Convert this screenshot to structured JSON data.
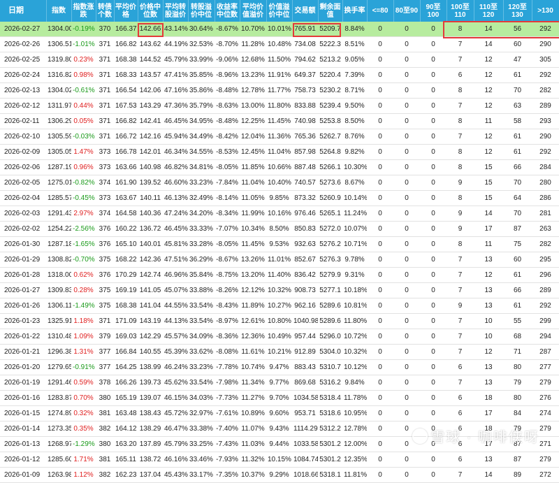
{
  "headers": [
    "日期",
    "指数",
    "指数涨跌",
    "转债个数",
    "平均价格",
    "价格中位数",
    "平均转股溢价",
    "转股溢价中位",
    "收益率中位数",
    "平均价值溢价",
    "价值溢价中位",
    "交易额",
    "剩余面值",
    "换手率",
    "<=80",
    "80至90",
    "90至100",
    "100至110",
    "110至120",
    "120至130",
    ">130"
  ],
  "rows": [
    {
      "date": "2026-02-27",
      "index": "1304.00",
      "chg": "-0.19%",
      "dir": "neg",
      "count": "370",
      "avg_price": "166.37",
      "median_price": "142.66",
      "avg_conv": "43.14%",
      "med_conv": "30.64%",
      "yield": "-8.67%",
      "avg_val": "10.70%",
      "med_val": "10.01%",
      "trade": "765.91",
      "face": "5209.7",
      "turnover": "8.84%",
      "b1": "0",
      "b2": "0",
      "b3": "0",
      "b4": "8",
      "b5": "14",
      "b6": "56",
      "b7": "292"
    },
    {
      "date": "2026-02-26",
      "index": "1306.51",
      "chg": "-1.01%",
      "dir": "neg",
      "count": "371",
      "avg_price": "166.82",
      "median_price": "143.62",
      "avg_conv": "44.19%",
      "med_conv": "32.53%",
      "yield": "-8.70%",
      "avg_val": "11.28%",
      "med_val": "10.48%",
      "trade": "734.08",
      "face": "5222.3",
      "turnover": "8.51%",
      "b1": "0",
      "b2": "0",
      "b3": "0",
      "b4": "7",
      "b5": "14",
      "b6": "60",
      "b7": "290"
    },
    {
      "date": "2026-02-25",
      "index": "1319.80",
      "chg": "0.23%",
      "dir": "pos",
      "count": "371",
      "avg_price": "168.38",
      "median_price": "144.52",
      "avg_conv": "45.79%",
      "med_conv": "33.99%",
      "yield": "-9.06%",
      "avg_val": "12.68%",
      "med_val": "11.50%",
      "trade": "794.62",
      "face": "5213.2",
      "turnover": "9.05%",
      "b1": "0",
      "b2": "0",
      "b3": "0",
      "b4": "7",
      "b5": "12",
      "b6": "47",
      "b7": "305"
    },
    {
      "date": "2026-02-24",
      "index": "1316.82",
      "chg": "0.98%",
      "dir": "pos",
      "count": "371",
      "avg_price": "168.33",
      "median_price": "143.57",
      "avg_conv": "47.41%",
      "med_conv": "35.85%",
      "yield": "-8.96%",
      "avg_val": "13.23%",
      "med_val": "11.91%",
      "trade": "649.37",
      "face": "5220.4",
      "turnover": "7.39%",
      "b1": "0",
      "b2": "0",
      "b3": "0",
      "b4": "6",
      "b5": "12",
      "b6": "61",
      "b7": "292"
    },
    {
      "date": "2026-02-13",
      "index": "1304.02",
      "chg": "-0.61%",
      "dir": "neg",
      "count": "371",
      "avg_price": "166.54",
      "median_price": "142.06",
      "avg_conv": "47.16%",
      "med_conv": "35.86%",
      "yield": "-8.48%",
      "avg_val": "12.78%",
      "med_val": "11.77%",
      "trade": "758.73",
      "face": "5230.2",
      "turnover": "8.71%",
      "b1": "0",
      "b2": "0",
      "b3": "0",
      "b4": "8",
      "b5": "12",
      "b6": "70",
      "b7": "282"
    },
    {
      "date": "2026-02-12",
      "index": "1311.97",
      "chg": "0.44%",
      "dir": "pos",
      "count": "371",
      "avg_price": "167.53",
      "median_price": "143.29",
      "avg_conv": "47.36%",
      "med_conv": "35.79%",
      "yield": "-8.63%",
      "avg_val": "13.00%",
      "med_val": "11.80%",
      "trade": "833.88",
      "face": "5239.4",
      "turnover": "9.50%",
      "b1": "0",
      "b2": "0",
      "b3": "0",
      "b4": "7",
      "b5": "12",
      "b6": "63",
      "b7": "289"
    },
    {
      "date": "2026-02-11",
      "index": "1306.29",
      "chg": "0.05%",
      "dir": "pos",
      "count": "371",
      "avg_price": "166.82",
      "median_price": "142.41",
      "avg_conv": "46.45%",
      "med_conv": "34.95%",
      "yield": "-8.48%",
      "avg_val": "12.25%",
      "med_val": "11.45%",
      "trade": "740.98",
      "face": "5253.8",
      "turnover": "8.50%",
      "b1": "0",
      "b2": "0",
      "b3": "0",
      "b4": "8",
      "b5": "11",
      "b6": "58",
      "b7": "293"
    },
    {
      "date": "2026-02-10",
      "index": "1305.59",
      "chg": "-0.03%",
      "dir": "neg",
      "count": "371",
      "avg_price": "166.72",
      "median_price": "142.16",
      "avg_conv": "45.94%",
      "med_conv": "34.49%",
      "yield": "-8.42%",
      "avg_val": "12.04%",
      "med_val": "11.36%",
      "trade": "765.36",
      "face": "5262.7",
      "turnover": "8.76%",
      "b1": "0",
      "b2": "0",
      "b3": "0",
      "b4": "7",
      "b5": "12",
      "b6": "61",
      "b7": "290"
    },
    {
      "date": "2026-02-09",
      "index": "1305.05",
      "chg": "1.47%",
      "dir": "pos",
      "count": "373",
      "avg_price": "166.78",
      "median_price": "142.01",
      "avg_conv": "46.34%",
      "med_conv": "34.55%",
      "yield": "-8.53%",
      "avg_val": "12.45%",
      "med_val": "11.04%",
      "trade": "857.98",
      "face": "5264.8",
      "turnover": "9.82%",
      "b1": "0",
      "b2": "0",
      "b3": "0",
      "b4": "8",
      "b5": "12",
      "b6": "61",
      "b7": "292"
    },
    {
      "date": "2026-02-06",
      "index": "1287.19",
      "chg": "0.96%",
      "dir": "pos",
      "count": "373",
      "avg_price": "163.66",
      "median_price": "140.98",
      "avg_conv": "46.82%",
      "med_conv": "34.81%",
      "yield": "-8.05%",
      "avg_val": "11.85%",
      "med_val": "10.66%",
      "trade": "887.48",
      "face": "5266.1",
      "turnover": "10.30%",
      "b1": "0",
      "b2": "0",
      "b3": "0",
      "b4": "8",
      "b5": "15",
      "b6": "66",
      "b7": "284"
    },
    {
      "date": "2026-02-05",
      "index": "1275.01",
      "chg": "-0.82%",
      "dir": "neg",
      "count": "374",
      "avg_price": "161.90",
      "median_price": "139.52",
      "avg_conv": "46.60%",
      "med_conv": "33.23%",
      "yield": "-7.84%",
      "avg_val": "11.04%",
      "med_val": "10.40%",
      "trade": "740.57",
      "face": "5273.6",
      "turnover": "8.67%",
      "b1": "0",
      "b2": "0",
      "b3": "0",
      "b4": "9",
      "b5": "15",
      "b6": "70",
      "b7": "280"
    },
    {
      "date": "2026-02-04",
      "index": "1285.57",
      "chg": "-0.45%",
      "dir": "neg",
      "count": "373",
      "avg_price": "163.67",
      "median_price": "140.11",
      "avg_conv": "46.13%",
      "med_conv": "32.49%",
      "yield": "-8.14%",
      "avg_val": "11.05%",
      "med_val": "9.85%",
      "trade": "873.32",
      "face": "5260.9",
      "turnover": "10.14%",
      "b1": "0",
      "b2": "0",
      "b3": "0",
      "b4": "8",
      "b5": "15",
      "b6": "64",
      "b7": "286"
    },
    {
      "date": "2026-02-03",
      "index": "1291.43",
      "chg": "2.97%",
      "dir": "pos",
      "count": "374",
      "avg_price": "164.58",
      "median_price": "140.36",
      "avg_conv": "47.24%",
      "med_conv": "34.20%",
      "yield": "-8.34%",
      "avg_val": "11.99%",
      "med_val": "10.16%",
      "trade": "976.46",
      "face": "5265.1",
      "turnover": "11.24%",
      "b1": "0",
      "b2": "0",
      "b3": "0",
      "b4": "9",
      "b5": "14",
      "b6": "70",
      "b7": "281"
    },
    {
      "date": "2026-02-02",
      "index": "1254.22",
      "chg": "-2.56%",
      "dir": "neg",
      "count": "376",
      "avg_price": "160.22",
      "median_price": "136.72",
      "avg_conv": "46.45%",
      "med_conv": "33.33%",
      "yield": "-7.07%",
      "avg_val": "10.34%",
      "med_val": "8.50%",
      "trade": "850.83",
      "face": "5272.0",
      "turnover": "10.07%",
      "b1": "0",
      "b2": "0",
      "b3": "0",
      "b4": "9",
      "b5": "17",
      "b6": "87",
      "b7": "263"
    },
    {
      "date": "2026-01-30",
      "index": "1287.18",
      "chg": "-1.65%",
      "dir": "neg",
      "count": "376",
      "avg_price": "165.10",
      "median_price": "140.01",
      "avg_conv": "45.81%",
      "med_conv": "33.28%",
      "yield": "-8.05%",
      "avg_val": "11.45%",
      "med_val": "9.53%",
      "trade": "932.63",
      "face": "5276.2",
      "turnover": "10.71%",
      "b1": "0",
      "b2": "0",
      "b3": "0",
      "b4": "8",
      "b5": "11",
      "b6": "75",
      "b7": "282"
    },
    {
      "date": "2026-01-29",
      "index": "1308.82",
      "chg": "-0.70%",
      "dir": "neg",
      "count": "375",
      "avg_price": "168.22",
      "median_price": "142.36",
      "avg_conv": "47.51%",
      "med_conv": "36.29%",
      "yield": "-8.67%",
      "avg_val": "13.26%",
      "med_val": "11.01%",
      "trade": "852.67",
      "face": "5276.3",
      "turnover": "9.78%",
      "b1": "0",
      "b2": "0",
      "b3": "0",
      "b4": "7",
      "b5": "13",
      "b6": "60",
      "b7": "295"
    },
    {
      "date": "2026-01-28",
      "index": "1318.00",
      "chg": "0.62%",
      "dir": "pos",
      "count": "376",
      "avg_price": "170.29",
      "median_price": "142.74",
      "avg_conv": "46.96%",
      "med_conv": "35.84%",
      "yield": "-8.75%",
      "avg_val": "13.20%",
      "med_val": "11.40%",
      "trade": "836.42",
      "face": "5279.9",
      "turnover": "9.31%",
      "b1": "0",
      "b2": "0",
      "b3": "0",
      "b4": "7",
      "b5": "12",
      "b6": "61",
      "b7": "296"
    },
    {
      "date": "2026-01-27",
      "index": "1309.83",
      "chg": "0.28%",
      "dir": "pos",
      "count": "375",
      "avg_price": "169.19",
      "median_price": "141.05",
      "avg_conv": "45.07%",
      "med_conv": "33.88%",
      "yield": "-8.26%",
      "avg_val": "12.12%",
      "med_val": "10.32%",
      "trade": "908.73",
      "face": "5277.1",
      "turnover": "10.18%",
      "b1": "0",
      "b2": "0",
      "b3": "0",
      "b4": "7",
      "b5": "13",
      "b6": "66",
      "b7": "289"
    },
    {
      "date": "2026-01-26",
      "index": "1306.11",
      "chg": "-1.49%",
      "dir": "neg",
      "count": "375",
      "avg_price": "168.38",
      "median_price": "141.04",
      "avg_conv": "44.55%",
      "med_conv": "33.54%",
      "yield": "-8.43%",
      "avg_val": "11.89%",
      "med_val": "10.27%",
      "trade": "962.16",
      "face": "5289.6",
      "turnover": "10.81%",
      "b1": "0",
      "b2": "0",
      "b3": "0",
      "b4": "9",
      "b5": "13",
      "b6": "61",
      "b7": "292"
    },
    {
      "date": "2026-01-23",
      "index": "1325.91",
      "chg": "1.18%",
      "dir": "pos",
      "count": "371",
      "avg_price": "171.09",
      "median_price": "143.19",
      "avg_conv": "44.13%",
      "med_conv": "33.54%",
      "yield": "-8.97%",
      "avg_val": "12.61%",
      "med_val": "10.80%",
      "trade": "1040.98",
      "face": "5289.6",
      "turnover": "11.80%",
      "b1": "0",
      "b2": "0",
      "b3": "0",
      "b4": "7",
      "b5": "10",
      "b6": "55",
      "b7": "299"
    },
    {
      "date": "2026-01-22",
      "index": "1310.48",
      "chg": "1.09%",
      "dir": "pos",
      "count": "379",
      "avg_price": "169.03",
      "median_price": "142.29",
      "avg_conv": "45.57%",
      "med_conv": "34.09%",
      "yield": "-8.36%",
      "avg_val": "12.36%",
      "med_val": "10.49%",
      "trade": "957.44",
      "face": "5296.0",
      "turnover": "10.72%",
      "b1": "0",
      "b2": "0",
      "b3": "0",
      "b4": "7",
      "b5": "10",
      "b6": "68",
      "b7": "294"
    },
    {
      "date": "2026-01-21",
      "index": "1296.38",
      "chg": "1.31%",
      "dir": "pos",
      "count": "377",
      "avg_price": "166.84",
      "median_price": "140.55",
      "avg_conv": "45.39%",
      "med_conv": "33.62%",
      "yield": "-8.08%",
      "avg_val": "11.61%",
      "med_val": "10.21%",
      "trade": "912.89",
      "face": "5304.0",
      "turnover": "10.32%",
      "b1": "0",
      "b2": "0",
      "b3": "0",
      "b4": "7",
      "b5": "12",
      "b6": "71",
      "b7": "287"
    },
    {
      "date": "2026-01-20",
      "index": "1279.65",
      "chg": "-0.91%",
      "dir": "neg",
      "count": "377",
      "avg_price": "164.25",
      "median_price": "138.99",
      "avg_conv": "46.24%",
      "med_conv": "33.23%",
      "yield": "-7.78%",
      "avg_val": "10.74%",
      "med_val": "9.47%",
      "trade": "883.43",
      "face": "5310.7",
      "turnover": "10.12%",
      "b1": "0",
      "b2": "0",
      "b3": "0",
      "b4": "6",
      "b5": "13",
      "b6": "80",
      "b7": "277"
    },
    {
      "date": "2026-01-19",
      "index": "1291.46",
      "chg": "0.59%",
      "dir": "pos",
      "count": "378",
      "avg_price": "166.26",
      "median_price": "139.73",
      "avg_conv": "45.62%",
      "med_conv": "33.54%",
      "yield": "-7.98%",
      "avg_val": "11.34%",
      "med_val": "9.77%",
      "trade": "869.68",
      "face": "5316.2",
      "turnover": "9.84%",
      "b1": "0",
      "b2": "0",
      "b3": "0",
      "b4": "7",
      "b5": "13",
      "b6": "79",
      "b7": "279"
    },
    {
      "date": "2026-01-16",
      "index": "1283.87",
      "chg": "0.70%",
      "dir": "pos",
      "count": "380",
      "avg_price": "165.19",
      "median_price": "139.07",
      "avg_conv": "46.15%",
      "med_conv": "34.03%",
      "yield": "-7.73%",
      "avg_val": "11.27%",
      "med_val": "9.70%",
      "trade": "1034.58",
      "face": "5318.4",
      "turnover": "11.78%",
      "b1": "0",
      "b2": "0",
      "b3": "0",
      "b4": "6",
      "b5": "18",
      "b6": "80",
      "b7": "276"
    },
    {
      "date": "2026-01-15",
      "index": "1274.89",
      "chg": "0.32%",
      "dir": "pos",
      "count": "381",
      "avg_price": "163.48",
      "median_price": "138.43",
      "avg_conv": "45.72%",
      "med_conv": "32.97%",
      "yield": "-7.61%",
      "avg_val": "10.89%",
      "med_val": "9.60%",
      "trade": "953.71",
      "face": "5318.6",
      "turnover": "10.95%",
      "b1": "0",
      "b2": "0",
      "b3": "0",
      "b4": "6",
      "b5": "17",
      "b6": "84",
      "b7": "274"
    },
    {
      "date": "2026-01-14",
      "index": "1273.35",
      "chg": "0.35%",
      "dir": "pos",
      "count": "382",
      "avg_price": "164.12",
      "median_price": "138.29",
      "avg_conv": "46.47%",
      "med_conv": "33.38%",
      "yield": "-7.40%",
      "avg_val": "11.07%",
      "med_val": "9.43%",
      "trade": "1114.29",
      "face": "5312.2",
      "turnover": "12.78%",
      "b1": "0",
      "b2": "0",
      "b3": "0",
      "b4": "6",
      "b5": "18",
      "b6": "79",
      "b7": "279"
    },
    {
      "date": "2026-01-13",
      "index": "1268.97",
      "chg": "-1.29%",
      "dir": "neg",
      "count": "380",
      "avg_price": "163.20",
      "median_price": "137.89",
      "avg_conv": "45.79%",
      "med_conv": "33.25%",
      "yield": "-7.43%",
      "avg_val": "11.03%",
      "med_val": "9.44%",
      "trade": "1033.58",
      "face": "5301.2",
      "turnover": "12.00%",
      "b1": "0",
      "b2": "0",
      "b3": "0",
      "b4": "6",
      "b5": "17",
      "b6": "87",
      "b7": "271"
    },
    {
      "date": "2026-01-12",
      "index": "1285.60",
      "chg": "1.71%",
      "dir": "pos",
      "count": "381",
      "avg_price": "165.11",
      "median_price": "138.72",
      "avg_conv": "46.16%",
      "med_conv": "33.46%",
      "yield": "-7.93%",
      "avg_val": "11.32%",
      "med_val": "10.15%",
      "trade": "1084.74",
      "face": "5301.2",
      "turnover": "12.35%",
      "b1": "0",
      "b2": "0",
      "b3": "0",
      "b4": "6",
      "b5": "13",
      "b6": "87",
      "b7": "279"
    },
    {
      "date": "2026-01-09",
      "index": "1263.98",
      "chg": "1.12%",
      "dir": "pos",
      "count": "382",
      "avg_price": "162.23",
      "median_price": "137.04",
      "avg_conv": "45.43%",
      "med_conv": "33.17%",
      "yield": "-7.35%",
      "avg_val": "10.37%",
      "med_val": "9.29%",
      "trade": "1018.66",
      "face": "5318.1",
      "turnover": "11.81%",
      "b1": "0",
      "b2": "0",
      "b3": "0",
      "b4": "7",
      "b5": "14",
      "b6": "89",
      "b7": "272"
    }
  ],
  "watermark": {
    "text": "雪球 · 咖啡侠呀"
  },
  "colors": {
    "header": "#2aa3d8",
    "highlight": "#b7ec9f",
    "positive": "#e02020",
    "negative": "#1a9a1a",
    "box": "#e43a3a"
  }
}
